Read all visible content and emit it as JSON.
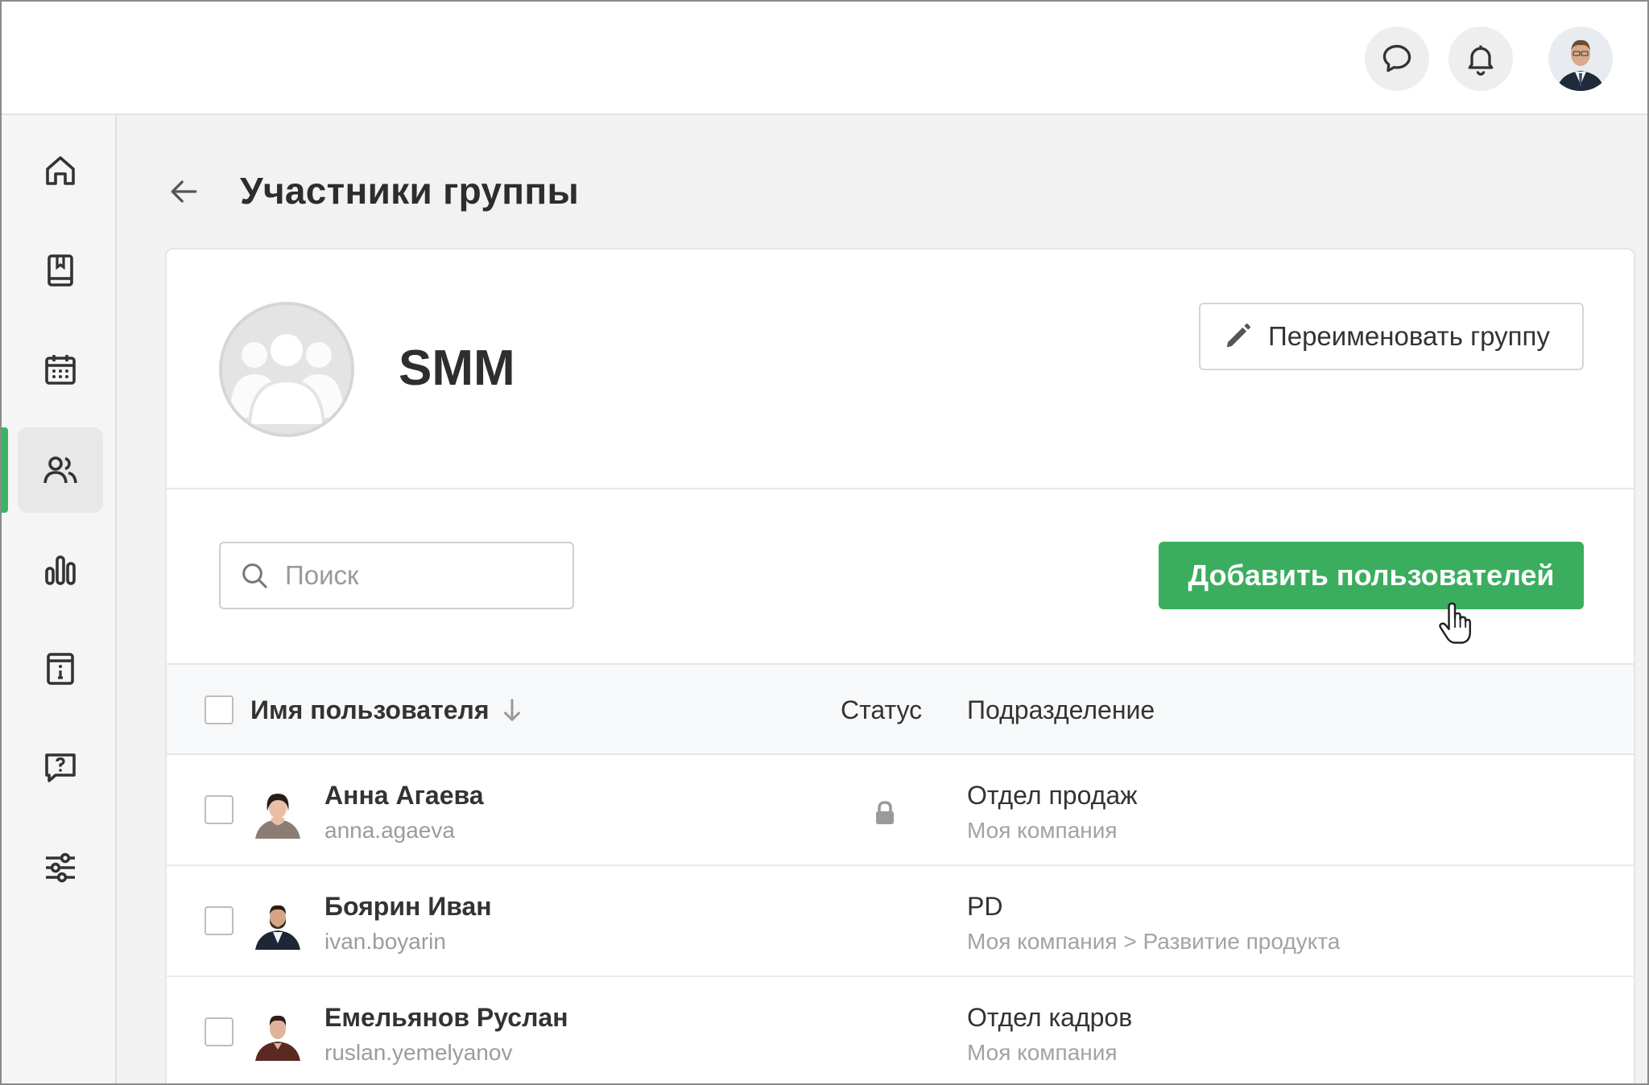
{
  "header": {
    "page_title": "Участники группы"
  },
  "group": {
    "name": "SMM",
    "rename_label": "Переименовать группу"
  },
  "toolbar": {
    "search_placeholder": "Поиск",
    "add_users_label": "Добавить пользователей"
  },
  "table": {
    "columns": {
      "name": "Имя пользователя",
      "status": "Статус",
      "department": "Подразделение"
    },
    "rows": [
      {
        "name": "Анна Агаева",
        "login": "anna.agaeva",
        "status": "lock-icon",
        "department": "Отдел продаж",
        "path": "Моя компания"
      },
      {
        "name": "Боярин Иван",
        "login": "ivan.boyarin",
        "status": "",
        "department": "PD",
        "path": "Моя компания > Развитие продукта"
      },
      {
        "name": "Емельянов Руслан",
        "login": "ruslan.yemelyanov",
        "status": "",
        "department": "Отдел кадров",
        "path": "Моя компания"
      }
    ]
  },
  "sidebar": {
    "items": [
      "home-icon",
      "book-icon",
      "calendar-icon",
      "users-icon",
      "chart-icon",
      "info-icon",
      "help-icon",
      "settings-sliders-icon"
    ],
    "active": "users-icon"
  },
  "colors": {
    "accent": "#3aae5e",
    "background": "#f2f2f2"
  }
}
